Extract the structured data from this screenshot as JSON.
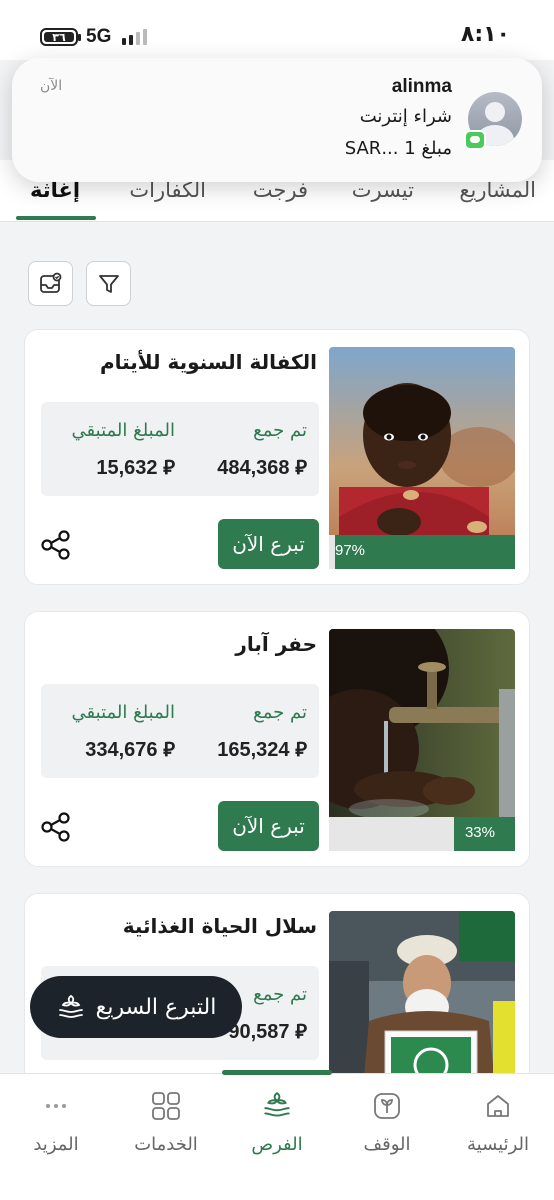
{
  "status_bar": {
    "time": "٨:١٠",
    "network": "5G",
    "battery_level": "٣٦"
  },
  "notification": {
    "app": "alinma",
    "line1": "شراء إنترنت",
    "line2": "مبلغ 1 ...SAR",
    "time": "الآن",
    "badge_color": "#4bc95a"
  },
  "tabs": [
    {
      "label": "المشاريع",
      "active": false
    },
    {
      "label": "تيسرت",
      "active": false
    },
    {
      "label": "فرجت",
      "active": false
    },
    {
      "label": "الكفارات",
      "active": false
    },
    {
      "label": "إغاثة",
      "active": true
    }
  ],
  "toolbar": {
    "filter_icon": "filter-icon",
    "saved_icon": "saved-box-icon"
  },
  "cards": [
    {
      "title": "الكفالة السنوية للأيتام",
      "collected_label": "تم جمع",
      "collected_value": "484,368",
      "remaining_label": "المبلغ المتبقي",
      "remaining_value": "15,632",
      "currency": "⃁",
      "button": "تبرع الآن",
      "progress": 97,
      "progress_label": "97%"
    },
    {
      "title": "حفر آبار",
      "collected_label": "تم جمع",
      "collected_value": "165,324",
      "remaining_label": "المبلغ المتبقي",
      "remaining_value": "334,676",
      "currency": "⃁",
      "button": "تبرع الآن",
      "progress": 33,
      "progress_label": "33%"
    },
    {
      "title": "سلال الحياة الغذائية",
      "collected_label": "تم جمع",
      "collected_value": "90,587",
      "currency": "⃁"
    }
  ],
  "quick_donate": {
    "label": "التبرع السريع"
  },
  "bottom_nav": [
    {
      "label": "الرئيسية",
      "icon": "home-icon",
      "active": false
    },
    {
      "label": "الوقف",
      "icon": "waqf-icon",
      "active": false
    },
    {
      "label": "الفرص",
      "icon": "opportunities-icon",
      "active": true
    },
    {
      "label": "الخدمات",
      "icon": "services-grid-icon",
      "active": false
    },
    {
      "label": "المزيد",
      "icon": "more-dots-icon",
      "active": false
    }
  ],
  "colors": {
    "accent": "#2f7a4e",
    "quick_donate_bg": "#1d232a"
  }
}
